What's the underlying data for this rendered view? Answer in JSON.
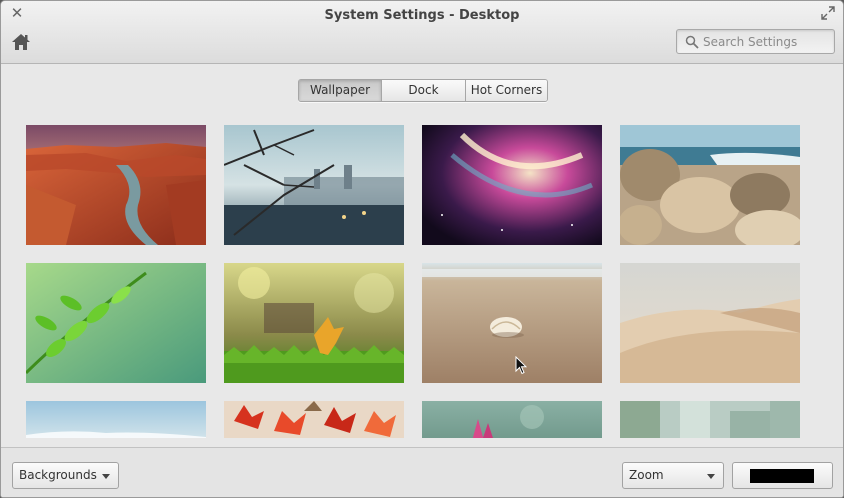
{
  "window": {
    "title": "System Settings - Desktop"
  },
  "header": {
    "search_placeholder": "Search Settings",
    "search_value": ""
  },
  "tabs": [
    {
      "label": "Wallpaper",
      "active": true
    },
    {
      "label": "Dock",
      "active": false
    },
    {
      "label": "Hot Corners",
      "active": false
    }
  ],
  "wallpapers": [
    {
      "icon": "canyon-river-photo"
    },
    {
      "icon": "frosted-branches-city-photo"
    },
    {
      "icon": "purple-nebula-photo"
    },
    {
      "icon": "rocky-seashore-photo"
    },
    {
      "icon": "green-fern-leaves-photo"
    },
    {
      "icon": "autumn-leaf-on-grass-photo"
    },
    {
      "icon": "seashell-on-beach-photo"
    },
    {
      "icon": "sand-dunes-photo"
    },
    {
      "icon": "sky-horizon-photo"
    },
    {
      "icon": "red-maple-leaves-photo"
    },
    {
      "icon": "pink-flowers-photo"
    },
    {
      "icon": "blurred-green-photo"
    }
  ],
  "footer": {
    "source_label": "Backgrounds",
    "fit_label": "Zoom",
    "background_color": "#000000"
  },
  "colors": {
    "window_bg": "#e8e8e8",
    "accent_tab": "#d0d0d0"
  }
}
